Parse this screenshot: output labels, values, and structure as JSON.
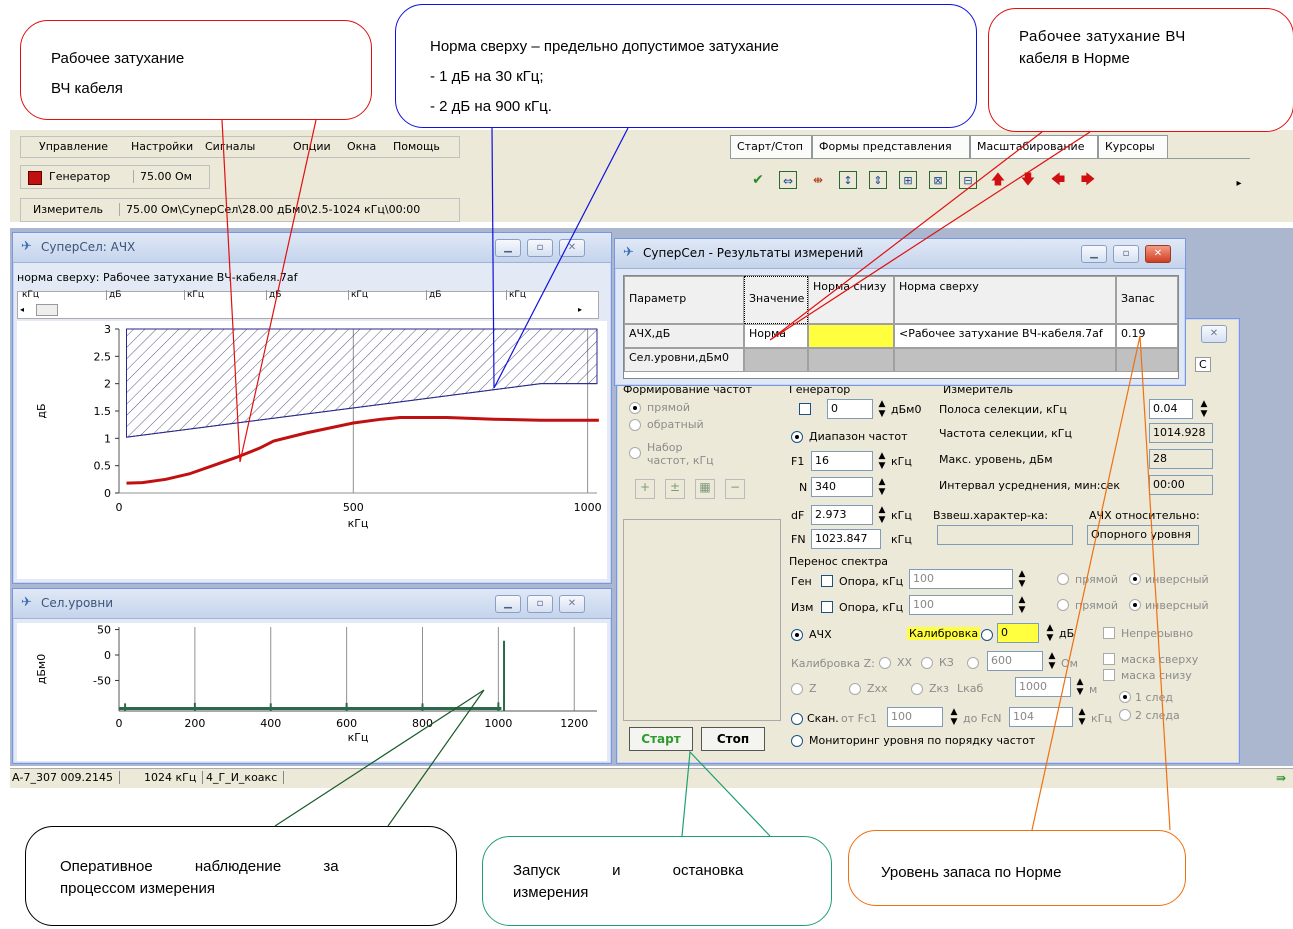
{
  "callouts": {
    "work_atten": {
      "line1": "Рабочее затухание",
      "line2": "ВЧ кабеля"
    },
    "norm_top": {
      "line1": "Норма сверху – предельно допустимое затухание",
      "line2": "- 1 дБ на 30 кГц;",
      "line3": "- 2 дБ на 900 кГц."
    },
    "work_norm": {
      "line1": "Рабочее затухание ВЧ",
      "line2": "кабеля в Норме"
    },
    "monitor": {
      "line1": "Оперативное наблюдение за",
      "line2": "процессом измерения"
    },
    "startstop": {
      "line1": "Запуск и остановка",
      "line2": "измерения"
    },
    "margin": {
      "line1": "Уровень запаса по Норме"
    }
  },
  "menu": [
    "Управление",
    "Настройки",
    "Сигналы",
    "Опции",
    "Окна",
    "Помощь"
  ],
  "generator": {
    "label": "Генератор",
    "value": "75.00 Ом"
  },
  "meter": {
    "label": "Измеритель",
    "value": "75.00 Ом\\СуперСел\\28.00 дБм0\\2.5-1024 кГц\\00:00"
  },
  "toolbar_tabs": [
    "Старт/Стоп",
    "Формы представления",
    "Масштабирование",
    "Курсоры"
  ],
  "toolbar_icons": [
    "brush-icon",
    "fit-icon",
    "zoom-x-icon",
    "zoom-y-icon",
    "fit-y-icon",
    "zoom-box-icon",
    "split-icon",
    "arrow-up-icon",
    "arrow-down-icon",
    "arrow-left-icon",
    "arrow-right-icon"
  ],
  "afc_window": {
    "title": "СуперСел: АЧХ",
    "subtitle": "норма сверху: Рабочее затухание ВЧ-кабеля.7af",
    "header_cells": [
      "кГц",
      "дБ",
      "кГц",
      "дБ",
      "кГц",
      "дБ",
      "кГц"
    ],
    "xlabel": "кГц",
    "ylabel": "дБ"
  },
  "sel_window": {
    "title": "Сел.уровни",
    "xlabel": "кГц",
    "ylabel": "дБм0"
  },
  "results_window": {
    "title": "СуперСел - Результаты измерений",
    "headers": [
      "Параметр",
      "Значение",
      "Норма снизу",
      "Норма сверху",
      "Запас"
    ],
    "rows": [
      [
        "АЧХ,дБ",
        "Норма",
        "",
        "<Рабочее затухание ВЧ-кабеля.7af",
        "0.19"
      ],
      [
        "Сел.уровни,дБм0",
        "",
        "",
        "",
        ""
      ]
    ]
  },
  "params": {
    "freq_form": "Формирование частот",
    "direct": "прямой",
    "reverse": "обратный",
    "freq_set": "Набор частот, кГц",
    "gen": "Генератор",
    "gen_value": "0",
    "gen_unit": "дБм0",
    "range": "Диапазон частот",
    "F1": "16",
    "N": "340",
    "dF": "2.973",
    "FN": "1023.847",
    "khz": "кГц",
    "meter": "Измеритель",
    "band_label": "Полоса селекции, кГц",
    "band_value": "0.04",
    "sel_freq_label": "Частота селекции, кГц",
    "sel_freq_value": "1014.928",
    "max_level_label": "Макс. уровень, дБм",
    "max_level_value": "28",
    "avg_label": "Интервал усреднения, мин:сек",
    "avg_value": "00:00",
    "weight_label": "Взвеш.характер-ка:",
    "afc_rel_label": "АЧХ относительно:",
    "afc_rel_value": "Опорного уровня",
    "transfer": "Перенос спектра",
    "gen_short": "Ген",
    "meter_short": "Изм",
    "support": "Опора, кГц",
    "support_value": "100",
    "direct_m": "прямой",
    "inverse": "инверсный",
    "afc": "АЧХ",
    "calibration": "Калибровка",
    "calib_value": "0",
    "db": "дБ",
    "continuous": "Непрерывно",
    "calibZ": "Калибровка Z:",
    "xx": "ХХ",
    "kz": "КЗ",
    "ohm_value": "600",
    "ohm": "Ом",
    "mask_top": "маска сверху",
    "mask_bottom": "маска снизу",
    "z": "Z",
    "zxx": "Zxx",
    "zkz": "Zкз",
    "lkab": "Lкаб",
    "lkab_value": "1000",
    "m": "м",
    "one_trace": "1 след",
    "two_trace": "2 следа",
    "scan": "Скан.",
    "from_fc1": "от Fc1",
    "fc1_value": "100",
    "to_fcn": "до FcN",
    "fcn_value": "104",
    "monitoring": "Мониторинг уровня по порядку частот",
    "start": "Старт",
    "stop": "Стоп",
    "partial_tab": "С"
  },
  "status_bar": [
    "А-7_307 009.2145",
    "1024 кГц",
    "4_Г_И_коакс"
  ],
  "chart_data": [
    {
      "type": "line",
      "title": "СуперСел: АЧХ",
      "xlabel": "кГц",
      "ylabel": "дБ",
      "xlim": [
        0,
        1020
      ],
      "ylim": [
        0,
        3
      ],
      "x_ticks": [
        0,
        500,
        1000
      ],
      "y_ticks": [
        0,
        0.5,
        1,
        1.5,
        2,
        2.5,
        3
      ],
      "series": [
        {
          "values": [
            [
              16,
              0.18
            ],
            [
              50,
              0.19
            ],
            [
              100,
              0.25
            ],
            [
              150,
              0.35
            ],
            [
              200,
              0.5
            ],
            [
              250,
              0.65
            ],
            [
              300,
              0.82
            ],
            [
              330,
              0.95
            ],
            [
              400,
              1.1
            ],
            [
              500,
              1.28
            ],
            [
              560,
              1.35
            ],
            [
              600,
              1.38
            ],
            [
              700,
              1.38
            ],
            [
              800,
              1.35
            ],
            [
              900,
              1.33
            ],
            [
              1024,
              1.33
            ]
          ]
        },
        {
          "values": [
            [
              16,
              1.02
            ],
            [
              900,
              2.0
            ],
            [
              1020,
              2.0
            ]
          ]
        },
        {
          "values": [
            [
              16,
              3.0
            ],
            [
              1020,
              3.0
            ]
          ]
        }
      ],
      "grid": true
    },
    {
      "type": "bar",
      "title": "Сел.уровни",
      "xlabel": "кГц",
      "ylabel": "дБм0",
      "xlim": [
        0,
        1260
      ],
      "ylim": [
        -110,
        55
      ],
      "x_ticks": [
        0,
        200,
        400,
        600,
        800,
        1000,
        1200
      ],
      "y_ticks": [
        50,
        0,
        -50
      ],
      "series": [
        {
          "values": [
            [
              16,
              -95
            ],
            [
              200,
              -94
            ],
            [
              400,
              -95
            ],
            [
              600,
              -94
            ],
            [
              800,
              -95
            ],
            [
              1000,
              -93
            ],
            [
              1014.9,
              28
            ]
          ]
        }
      ],
      "grid": true
    }
  ]
}
